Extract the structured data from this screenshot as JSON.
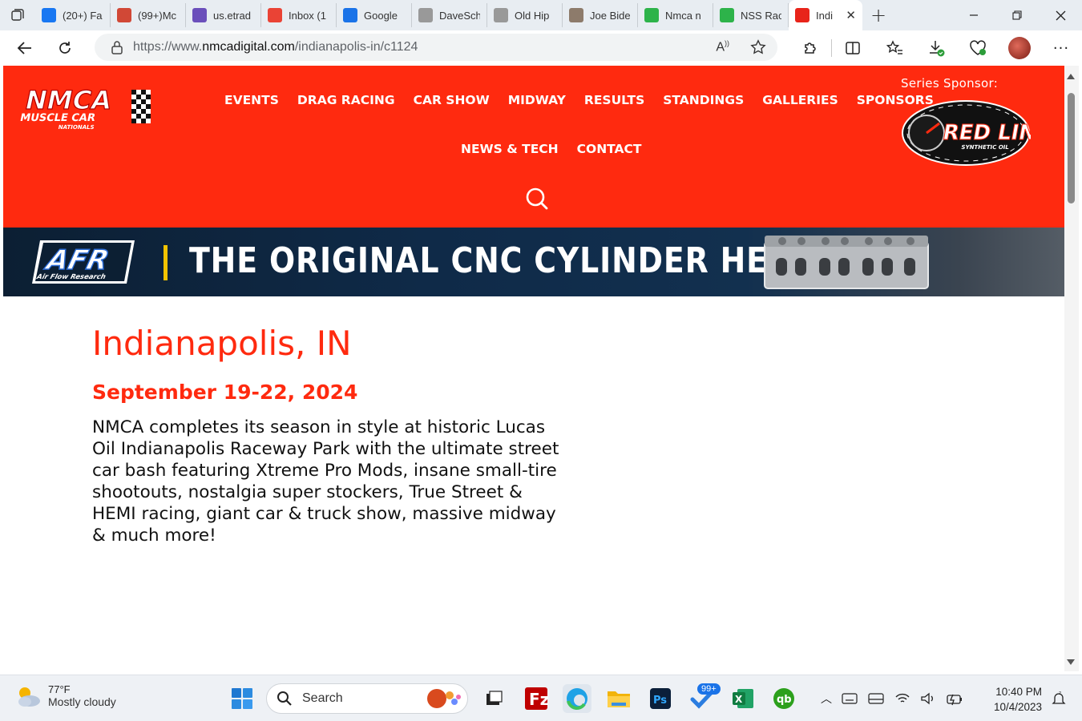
{
  "browser": {
    "tabs": [
      {
        "title": "(20+) Fa",
        "icon": "facebook-icon",
        "color": "#1877f2"
      },
      {
        "title": "(99+)Mc",
        "icon": "dots-icon",
        "color": "#d14836"
      },
      {
        "title": "us.etrad",
        "icon": "etrade-icon",
        "color": "#6b4fbb"
      },
      {
        "title": "Inbox (1",
        "icon": "gmail-icon",
        "color": "#ea4335"
      },
      {
        "title": "Google",
        "icon": "google-calendar-icon",
        "color": "#1a73e8"
      },
      {
        "title": "DaveSch",
        "icon": "profile-icon",
        "color": "#999999"
      },
      {
        "title": "Old Hip",
        "icon": "profile-icon",
        "color": "#999999"
      },
      {
        "title": "Joe Bide",
        "icon": "photo-icon",
        "color": "#8d7b6b"
      },
      {
        "title": "Nmca n",
        "icon": "green-thumb-icon",
        "color": "#2db34a"
      },
      {
        "title": "NSS Rac",
        "icon": "green-thumb-icon",
        "color": "#2db34a"
      },
      {
        "title": "Indi",
        "icon": "checkered-flag-icon",
        "color": "#e8241a",
        "active": true
      }
    ],
    "url_prefix": "https://www.",
    "url_domain": "nmcadigital.com",
    "url_path": "/indianapolis-in/c1124"
  },
  "site": {
    "logo_text": "NMCA",
    "logo_sub": "MUSCLE CAR",
    "logo_sub2": "NATIONALS",
    "nav_row1": [
      "EVENTS",
      "DRAG RACING",
      "CAR SHOW",
      "MIDWAY",
      "RESULTS",
      "STANDINGS",
      "GALLERIES",
      "SPONSORS"
    ],
    "nav_row2": [
      "NEWS & TECH",
      "CONTACT"
    ],
    "sponsor_label": "Series Sponsor:",
    "sponsor_name": "RED LINE",
    "sponsor_sub": "SYNTHETIC OIL",
    "banner_logo": "AFR",
    "banner_logo_sub": "Air Flow Research",
    "banner_text": "THE ORIGINAL CNC CYLINDER HEAD",
    "brand_color": "#ff2a0f"
  },
  "event": {
    "city": "Indianapolis, IN",
    "dates": "September 19-22, 2024",
    "description": "NMCA completes its season in style at historic Lucas Oil Indianapolis Raceway Park with the ultimate street car bash featuring Xtreme Pro Mods, insane small-tire shootouts, nostalgia super stockers, True Street & HEMI racing, giant car & truck show, massive midway & much more!"
  },
  "taskbar": {
    "weather_temp": "77°F",
    "weather_cond": "Mostly cloudy",
    "search_label": "Search",
    "badge": "99+",
    "time": "10:40 PM",
    "date": "10/4/2023"
  }
}
